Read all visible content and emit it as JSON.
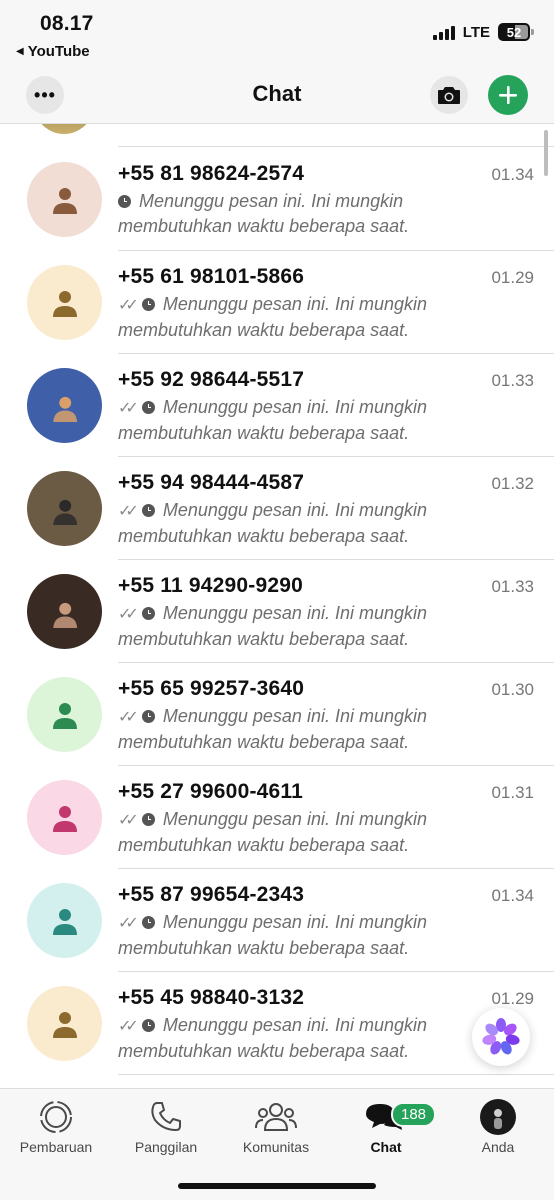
{
  "status_bar": {
    "time": "08.17",
    "back_app": "YouTube",
    "network": "LTE",
    "battery": "52"
  },
  "header": {
    "title": "Chat",
    "more_icon": "ellipsis-icon",
    "camera_icon": "camera-icon",
    "add_icon": "plus-icon"
  },
  "chats": [
    {
      "name": "+55 81 98624-2574",
      "time": "01.34",
      "message": "Menunggu pesan ini. Ini mungkin membutuhkan waktu beberapa saat.",
      "ticks": false,
      "avatar": {
        "type": "placeholder",
        "bg": "#f2ddd4",
        "fg": "#8a5a3c"
      }
    },
    {
      "name": "+55 61 98101-5866",
      "time": "01.29",
      "message": "Menunggu pesan ini. Ini mungkin membutuhkan waktu beberapa saat.",
      "ticks": true,
      "avatar": {
        "type": "placeholder",
        "bg": "#faebcf",
        "fg": "#8c6a2e"
      }
    },
    {
      "name": "+55 92 98644-5517",
      "time": "01.33",
      "message": "Menunggu pesan ini. Ini mungkin membutuhkan waktu beberapa saat.",
      "ticks": true,
      "avatar": {
        "type": "photo",
        "bg": "#3f5fa8",
        "fg": "#d9a06a"
      }
    },
    {
      "name": "+55 94 98444-4587",
      "time": "01.32",
      "message": "Menunggu pesan ini. Ini mungkin membutuhkan waktu beberapa saat.",
      "ticks": true,
      "avatar": {
        "type": "photo",
        "bg": "#6b5a44",
        "fg": "#2a2a2a"
      }
    },
    {
      "name": "+55 11 94290-9290",
      "time": "01.33",
      "message": "Menunggu pesan ini. Ini mungkin membutuhkan waktu beberapa saat.",
      "ticks": true,
      "avatar": {
        "type": "photo",
        "bg": "#3a2a24",
        "fg": "#c79a7e"
      }
    },
    {
      "name": "+55 65 99257-3640",
      "time": "01.30",
      "message": "Menunggu pesan ini. Ini mungkin membutuhkan waktu beberapa saat.",
      "ticks": true,
      "avatar": {
        "type": "placeholder",
        "bg": "#dcf5d8",
        "fg": "#2d8a50"
      }
    },
    {
      "name": "+55 27 99600-4611",
      "time": "01.31",
      "message": "Menunggu pesan ini. Ini mungkin membutuhkan waktu beberapa saat.",
      "ticks": true,
      "avatar": {
        "type": "placeholder",
        "bg": "#fad8e6",
        "fg": "#c0386e"
      }
    },
    {
      "name": "+55 87 99654-2343",
      "time": "01.34",
      "message": "Menunggu pesan ini. Ini mungkin membutuhkan waktu beberapa saat.",
      "ticks": true,
      "avatar": {
        "type": "placeholder",
        "bg": "#d3f0ee",
        "fg": "#2a8a80"
      }
    },
    {
      "name": "+55 45 98840-3132",
      "time": "01.29",
      "message": "Menunggu pesan ini. Ini mungkin membutuhkan waktu beberapa saat.",
      "ticks": true,
      "avatar": {
        "type": "placeholder",
        "bg": "#faebcf",
        "fg": "#8c6a2e"
      }
    }
  ],
  "tabs": [
    {
      "label": "Pembaruan",
      "icon": "updates-icon"
    },
    {
      "label": "Panggilan",
      "icon": "phone-icon"
    },
    {
      "label": "Komunitas",
      "icon": "community-icon"
    },
    {
      "label": "Chat",
      "icon": "chat-icon",
      "badge": "188",
      "active": true
    },
    {
      "label": "Anda",
      "icon": "profile-avatar-icon"
    }
  ],
  "colors": {
    "accent": "#25a35a",
    "separator": "#dcdcdc",
    "secondary_text": "#6e6e6e"
  }
}
